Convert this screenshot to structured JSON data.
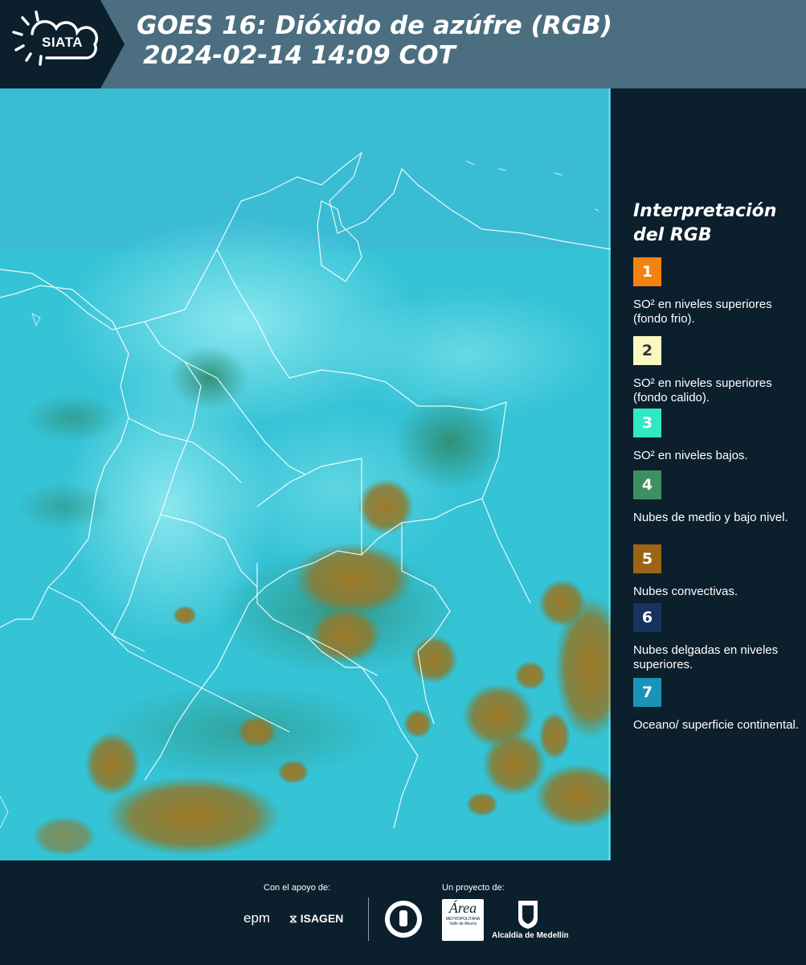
{
  "header": {
    "logo_text": "SIATA",
    "title_line1": "GOES 16: Dióxido de azúfre (RGB)",
    "title_line2": "2024-02-14 14:09 COT"
  },
  "legend": {
    "title_line1": "Interpretación",
    "title_line2": "del RGB",
    "items": [
      {
        "number": "1",
        "color": "#f5820f",
        "label": "SO² en niveles superiores (fondo frio)."
      },
      {
        "number": "2",
        "color": "#fbf6c2",
        "label": "SO² en niveles superiores (fondo calido)."
      },
      {
        "number": "3",
        "color": "#2fe8c4",
        "label": "SO² en niveles bajos."
      },
      {
        "number": "4",
        "color": "#3e8f62",
        "label": "Nubes de medio y bajo nivel."
      },
      {
        "number": "5",
        "color": "#9c6414",
        "label": "Nubes convectivas."
      },
      {
        "number": "6",
        "color": "#15335e",
        "label": "Nubes delgadas en niveles superiores."
      },
      {
        "number": "7",
        "color": "#1a93b8",
        "label": "Oceano/ superficie continental."
      }
    ]
  },
  "footer": {
    "support_label": "Con el apoyo de:",
    "project_label": "Un proyecto de:",
    "sponsor1": "epm",
    "sponsor2": "ISAGEN",
    "partner1_line1": "Área",
    "partner1_line2": "METROPOLITANA",
    "partner1_line3": "Valle de Aburrá",
    "partner2": "Alcaldía de Medellín"
  },
  "map": {
    "colors": {
      "ocean": "#33c2d6",
      "land_haze": "#7fe3ef",
      "convective": "#9c7a2a",
      "low_cloud": "#3a8f77",
      "border": "#ffffff"
    }
  }
}
